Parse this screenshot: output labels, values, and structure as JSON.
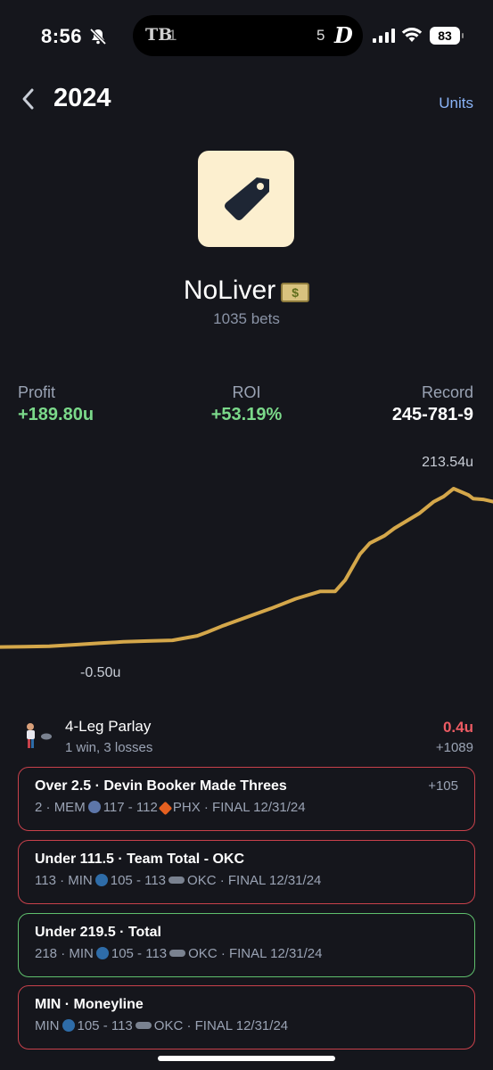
{
  "status_bar": {
    "time": "8:56",
    "island_left_team": "TB",
    "island_left_score": "1",
    "island_right_score": "5",
    "island_right_team": "D",
    "battery": "83"
  },
  "header": {
    "title": "2024",
    "units_label": "Units"
  },
  "profile": {
    "name": "NoLiver",
    "bets": "1035 bets"
  },
  "stats": {
    "profit_label": "Profit",
    "profit_value": "+189.80u",
    "roi_label": "ROI",
    "roi_value": "+53.19%",
    "record_label": "Record",
    "record_value": "245-781-9"
  },
  "chart_data": {
    "type": "line",
    "max_label": "213.54u",
    "min_label": "-0.50u",
    "line_color": "#d4a74a",
    "ylim": [
      -0.5,
      213.54
    ],
    "x": [
      0,
      5,
      10,
      15,
      20,
      25,
      30,
      35,
      40,
      42,
      45,
      50,
      55,
      60,
      65,
      68,
      70,
      73,
      75,
      78,
      80,
      85,
      88,
      90,
      92,
      95,
      96,
      98,
      100
    ],
    "y": [
      0,
      0.5,
      1,
      3,
      5,
      7,
      8,
      9,
      15,
      20,
      28,
      40,
      52,
      65,
      75,
      75,
      90,
      125,
      140,
      150,
      160,
      180,
      196,
      203,
      213.54,
      205,
      200,
      199,
      196
    ]
  },
  "parlay": {
    "title": "4-Leg Parlay",
    "subtitle": "1 win, 3 losses",
    "amount": "0.4u",
    "odds": "+1089"
  },
  "legs": [
    {
      "title": "Over 2.5 · Devin Booker Made Threes",
      "odds": "+105",
      "result": "loss",
      "value": "2",
      "team_a": "MEM",
      "logo_a": "mem",
      "score": "117 - 112",
      "team_b": "PHX",
      "logo_b": "phx",
      "final": "FINAL 12/31/24"
    },
    {
      "title": "Under 111.5 · Team Total - OKC",
      "odds": "",
      "result": "loss",
      "value": "113",
      "team_a": "MIN",
      "logo_a": "min",
      "score": "105 - 113",
      "team_b": "OKC",
      "logo_b": "okc",
      "final": "FINAL 12/31/24"
    },
    {
      "title": "Under 219.5 · Total",
      "odds": "",
      "result": "win",
      "value": "218",
      "team_a": "MIN",
      "logo_a": "min",
      "score": "105 - 113",
      "team_b": "OKC",
      "logo_b": "okc",
      "final": "FINAL 12/31/24"
    },
    {
      "title": "MIN · Moneyline",
      "odds": "",
      "result": "loss",
      "value": "",
      "team_a": "MIN",
      "logo_a": "min",
      "score": "105 - 113",
      "team_b": "OKC",
      "logo_b": "okc",
      "final": "FINAL 12/31/24"
    }
  ]
}
